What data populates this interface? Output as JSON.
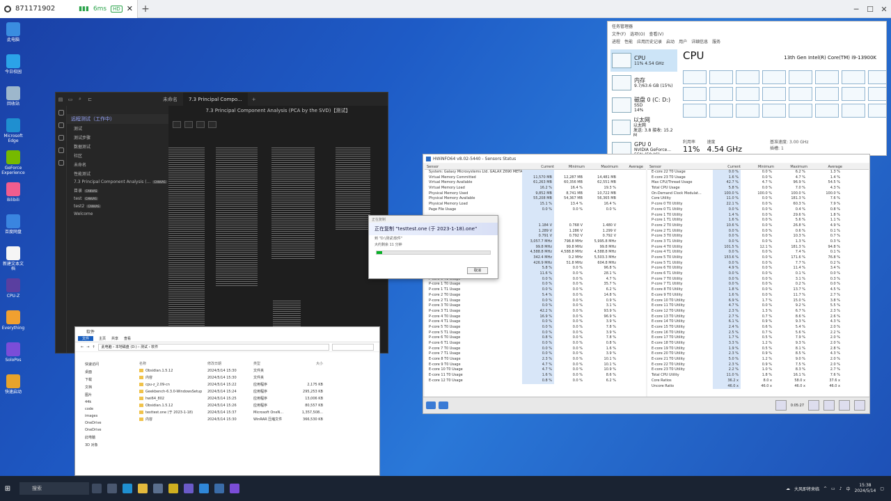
{
  "remote": {
    "session_id": "871171902",
    "latency": "6ms",
    "quality": "HD"
  },
  "desktop_icons": [
    "此电脑",
    "今日校园",
    "回收站",
    "Microsoft Edge",
    "GeForce Experience",
    "Bilibili",
    "百度网盘",
    "新建文本文档",
    "CPU-Z",
    "Everything",
    "SoloPos",
    "快速启动"
  ],
  "obsidian": {
    "tabs": [
      "未命名",
      "7.3 Principal Compo..."
    ],
    "doc_title": "7.3 Principal Component Analysis (PCA by the SVD)【测试】",
    "vault": "远程测试（工作中）",
    "items": [
      {
        "label": "测试",
        "tag": ""
      },
      {
        "label": "测试步骤",
        "tag": ""
      },
      {
        "label": "数据测试",
        "tag": ""
      },
      {
        "label": "社区",
        "tag": ""
      },
      {
        "label": "未命名",
        "tag": ""
      },
      {
        "label": "性能测试",
        "tag": ""
      },
      {
        "label": "7.3 Principal Component Analysis (...",
        "tag": "CANVAS"
      },
      {
        "label": "目录",
        "tag": "CANVAS"
      },
      {
        "label": "test",
        "tag": "CANVAS"
      },
      {
        "label": "test2",
        "tag": "CANVAS"
      },
      {
        "label": "Welcome",
        "tag": ""
      }
    ]
  },
  "taskmgr": {
    "title": "任务管理器",
    "menu": [
      "文件(F)",
      "选项(O)",
      "查看(V)"
    ],
    "tabs": [
      "进程",
      "性能",
      "应用历史记录",
      "启动",
      "用户",
      "详细信息",
      "服务"
    ],
    "resources": [
      {
        "name": "CPU",
        "detail": "11%  4.54 GHz"
      },
      {
        "name": "内存",
        "detail": "9.7/63.6 GB (15%)"
      },
      {
        "name": "磁盘 0 (C: D:)",
        "detail": "SSD",
        "extra": "14%"
      },
      {
        "name": "以太网",
        "detail": "以太网",
        "extra": "发送: 3.8 接收: 15.2 M"
      },
      {
        "name": "GPU 0",
        "detail": "NVIDIA GeForce...",
        "extra": "55% (59 °C)"
      }
    ],
    "cpu_heading": "CPU",
    "cpu_name": "13th Gen Intel(R) Core(TM) i9-13900K",
    "util_label": "利用率",
    "util_value": "11%",
    "speed_label": "速度",
    "speed_value": "4.54 GHz",
    "base_label": "基准速度:",
    "base_value": "3.00 GHz",
    "socket_label": "插槽:",
    "socket_value": "1"
  },
  "hwinfo": {
    "title": "HWiNFO64 v8.02-5440 - Sensors Status",
    "columns": [
      "Sensor",
      "Current",
      "Minimum",
      "Maximum",
      "Average"
    ],
    "left_rows": [
      {
        "n": "System: Galaxy Microsystems Ltd. GALAX Z690 METALTOP D4",
        "c": "",
        "mi": "",
        "ma": ""
      },
      {
        "n": "Virtual Memory Committed",
        "c": "11,570 MB",
        "mi": "12,287 MB",
        "ma": "14,481 MB"
      },
      {
        "n": "Virtual Memory Available",
        "c": "61,263 MB",
        "mi": "60,356 MB",
        "ma": "62,551 MB"
      },
      {
        "n": "Virtual Memory Load",
        "c": "16.2 %",
        "mi": "16.4 %",
        "ma": "19.3 %"
      },
      {
        "n": "Physical Memory Used",
        "c": "9,852 MB",
        "mi": "8,741 MB",
        "ma": "10,722 MB"
      },
      {
        "n": "Physical Memory Available",
        "c": "55,208 MB",
        "mi": "54,367 MB",
        "ma": "56,365 MB"
      },
      {
        "n": "Physical Memory Load",
        "c": "15.1 %",
        "mi": "13.4 %",
        "ma": "16.4 %"
      },
      {
        "n": "Page File Usage",
        "c": "0.0 %",
        "mi": "0.0 %",
        "ma": "0.0 %"
      },
      {
        "n": "",
        "c": "",
        "mi": "",
        "ma": ""
      },
      {
        "n": "",
        "c": "",
        "mi": "",
        "ma": ""
      },
      {
        "n": "",
        "c": "1.184 V",
        "mi": "0.768 V",
        "ma": "1.480 V"
      },
      {
        "n": "",
        "c": "1.289 V",
        "mi": "1.286 V",
        "ma": "1.299 V"
      },
      {
        "n": "",
        "c": "0.791 V",
        "mi": "0.792 V",
        "ma": "0.792 V"
      },
      {
        "n": "",
        "c": "3,057.7 MHz",
        "mi": "798.8 MHz",
        "ma": "5,995.8 MHz"
      },
      {
        "n": "",
        "c": "99.8 MHz",
        "mi": "99.8 MHz",
        "ma": "99.8 MHz"
      },
      {
        "n": "",
        "c": "4,588.8 MHz",
        "mi": "4,588.8 MHz",
        "ma": "4,588.8 MHz"
      },
      {
        "n": "",
        "c": "342.4 MHz",
        "mi": "0.2 MHz",
        "ma": "5,503.3 MHz"
      },
      {
        "n": "",
        "c": "426.9 MHz",
        "mi": "51.8 MHz",
        "ma": "604.8 MHz"
      },
      {
        "n": "",
        "c": "5.8 %",
        "mi": "0.0 %",
        "ma": "96.8 %"
      },
      {
        "n": "",
        "c": "11.6 %",
        "mi": "0.0 %",
        "ma": "28.1 %"
      },
      {
        "n": "P-core 0 T1 Usage",
        "c": "0.0 %",
        "mi": "0.0 %",
        "ma": "4.7 %"
      },
      {
        "n": "P-core 1 T0 Usage",
        "c": "0.0 %",
        "mi": "0.0 %",
        "ma": "35.7 %"
      },
      {
        "n": "P-core 1 T1 Usage",
        "c": "0.0 %",
        "mi": "0.0 %",
        "ma": "6.2 %"
      },
      {
        "n": "P-core 2 T0 Usage",
        "c": "5.4 %",
        "mi": "0.0 %",
        "ma": "14.8 %"
      },
      {
        "n": "P-core 2 T1 Usage",
        "c": "0.0 %",
        "mi": "0.0 %",
        "ma": "0.9 %"
      },
      {
        "n": "P-core 3 T0 Usage",
        "c": "0.0 %",
        "mi": "0.0 %",
        "ma": "3.1 %"
      },
      {
        "n": "P-core 3 T1 Usage",
        "c": "42.2 %",
        "mi": "0.0 %",
        "ma": "93.9 %"
      },
      {
        "n": "P-core 4 T0 Usage",
        "c": "16.9 %",
        "mi": "0.0 %",
        "ma": "96.9 %"
      },
      {
        "n": "P-core 4 T1 Usage",
        "c": "0.0 %",
        "mi": "0.0 %",
        "ma": "3.9 %"
      },
      {
        "n": "P-core 5 T0 Usage",
        "c": "0.0 %",
        "mi": "0.0 %",
        "ma": "7.8 %"
      },
      {
        "n": "P-core 5 T1 Usage",
        "c": "0.0 %",
        "mi": "0.0 %",
        "ma": "3.9 %"
      },
      {
        "n": "P-core 6 T0 Usage",
        "c": "0.8 %",
        "mi": "0.0 %",
        "ma": "7.8 %"
      },
      {
        "n": "P-core 6 T1 Usage",
        "c": "0.0 %",
        "mi": "0.0 %",
        "ma": "0.8 %"
      },
      {
        "n": "P-core 7 T0 Usage",
        "c": "0.0 %",
        "mi": "0.0 %",
        "ma": "1.6 %"
      },
      {
        "n": "P-core 7 T1 Usage",
        "c": "0.0 %",
        "mi": "0.0 %",
        "ma": "3.9 %"
      },
      {
        "n": "E-core 8 T0 Usage",
        "c": "2.3 %",
        "mi": "0.0 %",
        "ma": "10.1 %"
      },
      {
        "n": "E-core 9 T0 Usage",
        "c": "4.7 %",
        "mi": "0.0 %",
        "ma": "10.1 %"
      },
      {
        "n": "E-core 10 T0 Usage",
        "c": "4.7 %",
        "mi": "0.0 %",
        "ma": "10.9 %"
      },
      {
        "n": "E-core 11 T0 Usage",
        "c": "1.6 %",
        "mi": "0.0 %",
        "ma": "8.6 %"
      },
      {
        "n": "E-core 12 T0 Usage",
        "c": "0.8 %",
        "mi": "0.0 %",
        "ma": "6.2 %"
      }
    ],
    "right_rows": [
      {
        "n": "E-core 22 T0 Usage",
        "c": "0.0 %",
        "mi": "0.0 %",
        "ma": "6.2 %",
        "a": "1.3 %"
      },
      {
        "n": "E-core 23 T0 Usage",
        "c": "1.6 %",
        "mi": "0.0 %",
        "ma": "4.7 %",
        "a": "1.4 %"
      },
      {
        "n": "Max CPU/Thread Usage",
        "c": "42.7 %",
        "mi": "4.7 %",
        "ma": "96.9 %",
        "a": "54.5 %"
      },
      {
        "n": "Total CPU Usage",
        "c": "5.8 %",
        "mi": "0.0 %",
        "ma": "7.0 %",
        "a": "4.3 %"
      },
      {
        "n": "On-Demand Clock Modulat...",
        "c": "100.0 %",
        "mi": "100.0 %",
        "ma": "100.0 %",
        "a": "100.0 %"
      },
      {
        "n": "Core Utility",
        "c": "11.0 %",
        "mi": "0.0 %",
        "ma": "181.3 %",
        "a": "7.6 %"
      },
      {
        "n": "P-core 0 T0 Utility",
        "c": "22.1 %",
        "mi": "0.0 %",
        "ma": "60.3 %",
        "a": "7.9 %"
      },
      {
        "n": "P-core 0 T1 Utility",
        "c": "0.0 %",
        "mi": "0.0 %",
        "ma": "0.4 %",
        "a": "0.8 %"
      },
      {
        "n": "P-core 1 T0 Utility",
        "c": "1.4 %",
        "mi": "0.0 %",
        "ma": "29.6 %",
        "a": "1.8 %"
      },
      {
        "n": "P-core 1 T1 Utility",
        "c": "1.6 %",
        "mi": "0.0 %",
        "ma": "5.6 %",
        "a": "1.1 %"
      },
      {
        "n": "P-core 2 T0 Utility",
        "c": "10.6 %",
        "mi": "0.0 %",
        "ma": "26.8 %",
        "a": "4.9 %"
      },
      {
        "n": "P-core 2 T1 Utility",
        "c": "0.0 %",
        "mi": "0.0 %",
        "ma": "0.6 %",
        "a": "0.1 %"
      },
      {
        "n": "P-core 3 T0 Utility",
        "c": "0.0 %",
        "mi": "0.0 %",
        "ma": "10.3 %",
        "a": "0.7 %"
      },
      {
        "n": "P-core 3 T1 Utility",
        "c": "0.0 %",
        "mi": "0.0 %",
        "ma": "1.3 %",
        "a": "0.3 %"
      },
      {
        "n": "P-core 4 T0 Utility",
        "c": "101.5 %",
        "mi": "12.1 %",
        "ma": "181.3 %",
        "a": "94.8 %"
      },
      {
        "n": "P-core 4 T1 Utility",
        "c": "0.0 %",
        "mi": "0.0 %",
        "ma": "7.4 %",
        "a": "0.1 %"
      },
      {
        "n": "P-core 5 T0 Utility",
        "c": "153.6 %",
        "mi": "0.0 %",
        "ma": "171.6 %",
        "a": "76.8 %"
      },
      {
        "n": "P-core 5 T1 Utility",
        "c": "0.0 %",
        "mi": "0.0 %",
        "ma": "7.7 %",
        "a": "0.2 %"
      },
      {
        "n": "P-core 6 T0 Utility",
        "c": "4.9 %",
        "mi": "0.0 %",
        "ma": "11.4 %",
        "a": "3.4 %"
      },
      {
        "n": "P-core 6 T1 Utility",
        "c": "0.0 %",
        "mi": "0.0 %",
        "ma": "0.1 %",
        "a": "0.0 %"
      },
      {
        "n": "P-core 7 T0 Utility",
        "c": "0.0 %",
        "mi": "0.0 %",
        "ma": "3.1 %",
        "a": "0.3 %"
      },
      {
        "n": "P-core 7 T1 Utility",
        "c": "0.0 %",
        "mi": "0.0 %",
        "ma": "0.2 %",
        "a": "0.0 %"
      },
      {
        "n": "E-core 8 T0 Utility",
        "c": "1.8 %",
        "mi": "0.0 %",
        "ma": "13.7 %",
        "a": "4.5 %"
      },
      {
        "n": "E-core 9 T0 Utility",
        "c": "1.6 %",
        "mi": "0.0 %",
        "ma": "11.7 %",
        "a": "2.7 %"
      },
      {
        "n": "E-core 10 T0 Utility",
        "c": "6.9 %",
        "mi": "1.7 %",
        "ma": "15.0 %",
        "a": "3.8 %"
      },
      {
        "n": "E-core 11 T0 Utility",
        "c": "4.7 %",
        "mi": "0.0 %",
        "ma": "9.2 %",
        "a": "5.5 %"
      },
      {
        "n": "E-core 12 T0 Utility",
        "c": "2.3 %",
        "mi": "1.3 %",
        "ma": "6.7 %",
        "a": "2.3 %"
      },
      {
        "n": "E-core 13 T0 Utility",
        "c": "2.7 %",
        "mi": "0.7 %",
        "ma": "8.6 %",
        "a": "2.6 %"
      },
      {
        "n": "E-core 14 T0 Utility",
        "c": "6.1 %",
        "mi": "0.9 %",
        "ma": "9.3 %",
        "a": "4.3 %"
      },
      {
        "n": "E-core 15 T0 Utility",
        "c": "2.4 %",
        "mi": "0.6 %",
        "ma": "5.4 %",
        "a": "2.0 %"
      },
      {
        "n": "E-core 16 T0 Utility",
        "c": "2.5 %",
        "mi": "0.7 %",
        "ma": "5.6 %",
        "a": "2.2 %"
      },
      {
        "n": "E-core 17 T0 Utility",
        "c": "1.7 %",
        "mi": "0.5 %",
        "ma": "7.9 %",
        "a": "2.0 %"
      },
      {
        "n": "E-core 18 T0 Utility",
        "c": "3.3 %",
        "mi": "1.2 %",
        "ma": "9.3 %",
        "a": "2.0 %"
      },
      {
        "n": "E-core 19 T0 Utility",
        "c": "1.9 %",
        "mi": "0.5 %",
        "ma": "8.1 %",
        "a": "2.8 %"
      },
      {
        "n": "E-core 20 T0 Utility",
        "c": "2.3 %",
        "mi": "0.9 %",
        "ma": "8.5 %",
        "a": "4.3 %"
      },
      {
        "n": "E-core 21 T0 Utility",
        "c": "5.0 %",
        "mi": "1.2 %",
        "ma": "9.0 %",
        "a": "2.0 %"
      },
      {
        "n": "E-core 22 T0 Utility",
        "c": "2.3 %",
        "mi": "0.9 %",
        "ma": "7.5 %",
        "a": "2.0 %"
      },
      {
        "n": "E-core 23 T0 Utility",
        "c": "2.2 %",
        "mi": "1.0 %",
        "ma": "8.3 %",
        "a": "2.7 %"
      },
      {
        "n": "Total CPU Utility",
        "c": "11.0 %",
        "mi": "1.8 %",
        "ma": "16.1 %",
        "a": "7.6 %"
      },
      {
        "n": "Core Ratios",
        "c": "36.2 x",
        "mi": "8.0 x",
        "ma": "58.0 x",
        "a": "37.6 x"
      },
      {
        "n": "Uncore Ratio",
        "c": "46.0 x",
        "mi": "46.0 x",
        "ma": "46.0 x",
        "a": "46.0 x"
      }
    ],
    "timer": "0:05:27"
  },
  "copy_dialog": {
    "title": "正在复制",
    "heading": "正在复制 \"testtest.one (于 2023-1-18).one\"",
    "line1": "到 \"D:\\测试\\软件\"",
    "line2": "大约剩余 11 分钟",
    "progress_pct": 5,
    "cancel": "取消"
  },
  "explorer": {
    "title": "软件",
    "ribbon": [
      "文件",
      "主页",
      "共享",
      "查看"
    ],
    "path": "此电脑 › 本地磁盘 (D:) › 测试 › 软件",
    "columns": [
      "名称",
      "修改日期",
      "类型",
      "大小"
    ],
    "nav": [
      "快速访问",
      "桌面",
      "下载",
      "文档",
      "图片",
      "44k",
      "code",
      "images",
      "OneDrive",
      "OneDrive",
      "此电脑",
      "3D 对象"
    ],
    "files": [
      {
        "name": "Obsidian.1.5.12",
        "date": "2024/5/14 15:30",
        "type": "文件夹",
        "size": ""
      },
      {
        "name": "内容",
        "date": "2024/5/14 15:30",
        "type": "文件夹",
        "size": ""
      },
      {
        "name": "cpu-z_2.09-cn",
        "date": "2024/5/14 15:22",
        "type": "应用程序",
        "size": "2,175 KB"
      },
      {
        "name": "Geekbench-6.3.0-WindowsSetup",
        "date": "2024/5/14 15:24",
        "type": "应用程序",
        "size": "295,253 KB"
      },
      {
        "name": "hwi64_802",
        "date": "2024/5/14 15:25",
        "type": "应用程序",
        "size": "13,006 KB"
      },
      {
        "name": "Obsidian.1.5.12",
        "date": "2024/5/14 15:26",
        "type": "应用程序",
        "size": "80,557 KB"
      },
      {
        "name": "testtest.one (于 2023-1-18)",
        "date": "2024/5/14 15:37",
        "type": "Microsoft OneN...",
        "size": "1,357,508..."
      },
      {
        "name": "内容",
        "date": "2024/5/14 15:30",
        "type": "WinRAR 压缩文件",
        "size": "366,530 KB"
      }
    ]
  },
  "taskbar": {
    "search": "搜索",
    "weather": "大风即将来临",
    "lang": "中",
    "time": "15:38",
    "date": "2024/5/14"
  }
}
